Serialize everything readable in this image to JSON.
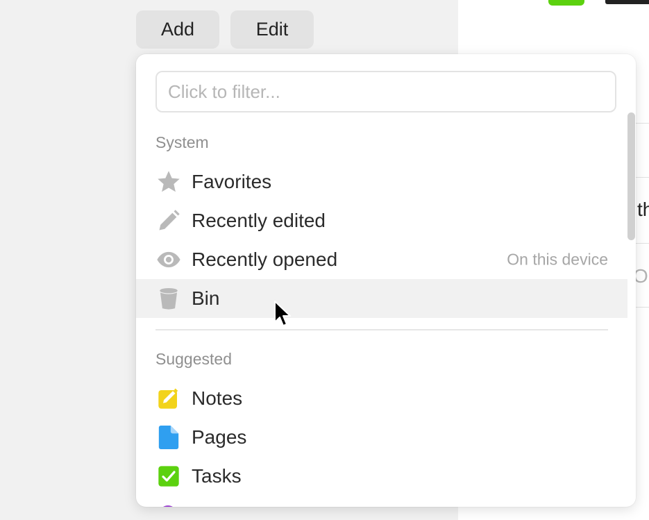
{
  "toolbar": {
    "add_label": "Add",
    "edit_label": "Edit"
  },
  "background": {
    "fragment_1": "th",
    "fragment_2": "Ob"
  },
  "filter": {
    "placeholder": "Click to filter..."
  },
  "sections": {
    "system": {
      "label": "System",
      "items": [
        {
          "label": "Favorites",
          "icon": "star-icon"
        },
        {
          "label": "Recently edited",
          "icon": "pencil-icon"
        },
        {
          "label": "Recently opened",
          "icon": "eye-icon",
          "hint": "On this device"
        },
        {
          "label": "Bin",
          "icon": "bin-icon",
          "hovered": true
        }
      ]
    },
    "suggested": {
      "label": "Suggested",
      "items": [
        {
          "label": "Notes",
          "icon": "notes-icon",
          "color": "#f2d31b"
        },
        {
          "label": "Pages",
          "icon": "page-icon",
          "color": "#2f9ff0"
        },
        {
          "label": "Tasks",
          "icon": "checkbox-icon",
          "color": "#5cd10f"
        }
      ]
    }
  },
  "colors": {
    "icon_gray": "#b9b9b9",
    "accent_green": "#5cd10f",
    "purple": "#9b3fd0"
  }
}
